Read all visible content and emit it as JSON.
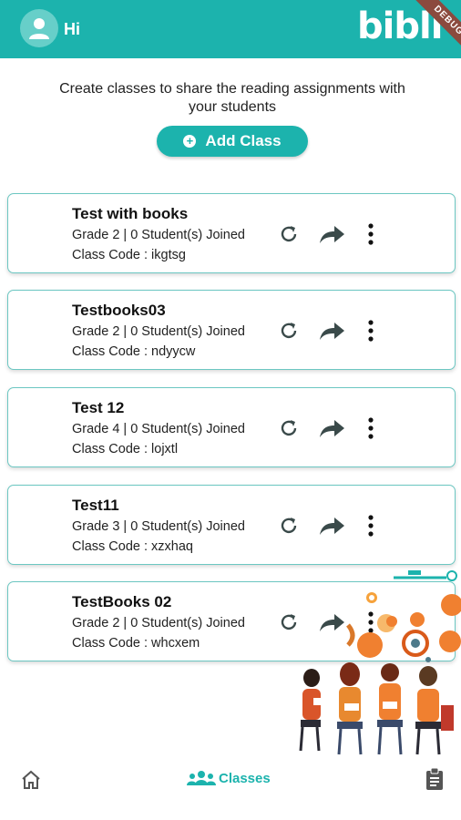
{
  "header": {
    "greeting": "Hi",
    "logo": "bibli",
    "debug_banner": "DEBUG",
    "avatar_icon": "person-icon"
  },
  "intro": {
    "text": "Create classes to share the reading assignments with your students"
  },
  "add_button": {
    "label": "Add Class",
    "icon": "plus-circle-icon"
  },
  "classes": [
    {
      "name": "Test with books",
      "meta": "Grade 2 | 0 Student(s) Joined",
      "code": "Class Code : ikgtsg"
    },
    {
      "name": "Testbooks03",
      "meta": "Grade 2 | 0 Student(s) Joined",
      "code": "Class Code : ndyycw"
    },
    {
      "name": "Test 12",
      "meta": "Grade 4 | 0 Student(s) Joined",
      "code": "Class Code : lojxtl"
    },
    {
      "name": "Test11",
      "meta": "Grade 3 | 0 Student(s) Joined",
      "code": "Class Code : xzxhaq"
    },
    {
      "name": "TestBooks 02",
      "meta": "Grade 2 | 0 Student(s) Joined",
      "code": "Class Code : whcxem"
    }
  ],
  "bottom_nav": {
    "home_icon": "home-icon",
    "classes_label": "Classes",
    "classes_icon": "people-icon",
    "assignments_icon": "clipboard-icon"
  },
  "colors": {
    "accent": "#1cb3ad",
    "card_border": "#6cc7c2",
    "icon": "#3a4a4a"
  }
}
